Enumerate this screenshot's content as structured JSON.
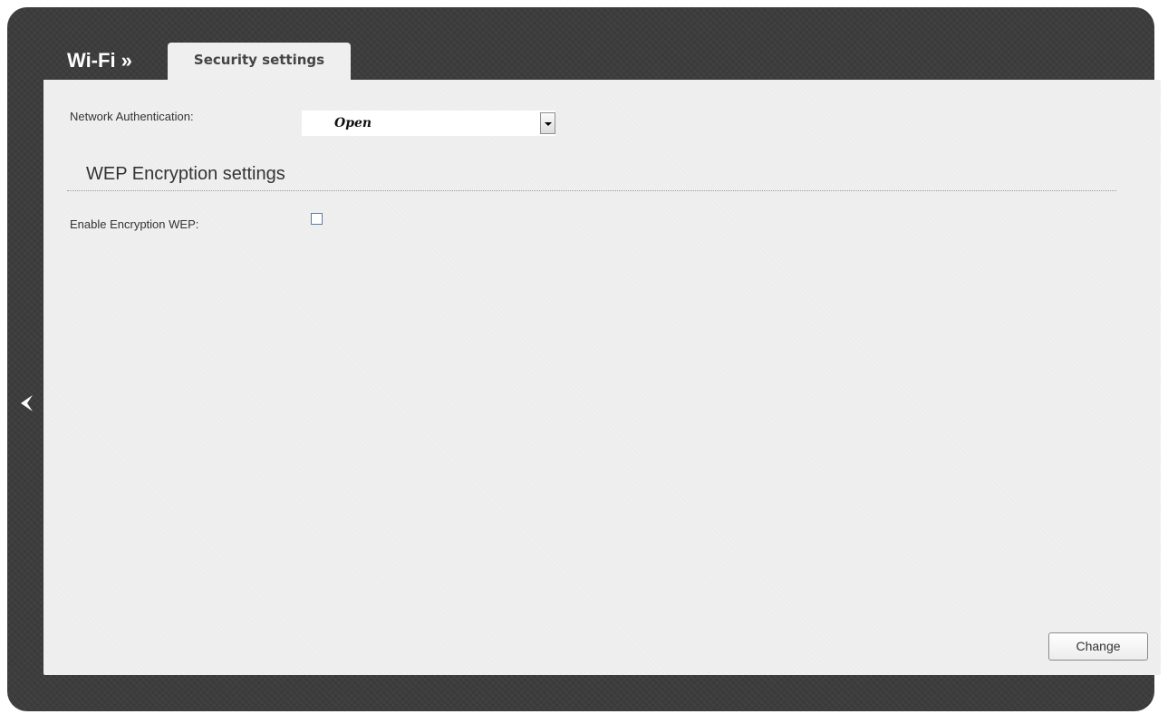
{
  "header": {
    "breadcrumb_root": "Wi-Fi »",
    "active_tab": "Security settings"
  },
  "form": {
    "network_auth": {
      "label": "Network Authentication:",
      "selected": "Open"
    },
    "wep_section": {
      "title": "WEP Encryption settings"
    },
    "enable_wep": {
      "label": "Enable Encryption WEP:",
      "checked": false
    }
  },
  "actions": {
    "change_label": "Change"
  },
  "icons": {
    "back": "chevron-left-icon",
    "dropdown": "chevron-down-icon"
  },
  "colors": {
    "frame": "#3d3d3d",
    "panel": "#efefef",
    "text": "#333333"
  }
}
